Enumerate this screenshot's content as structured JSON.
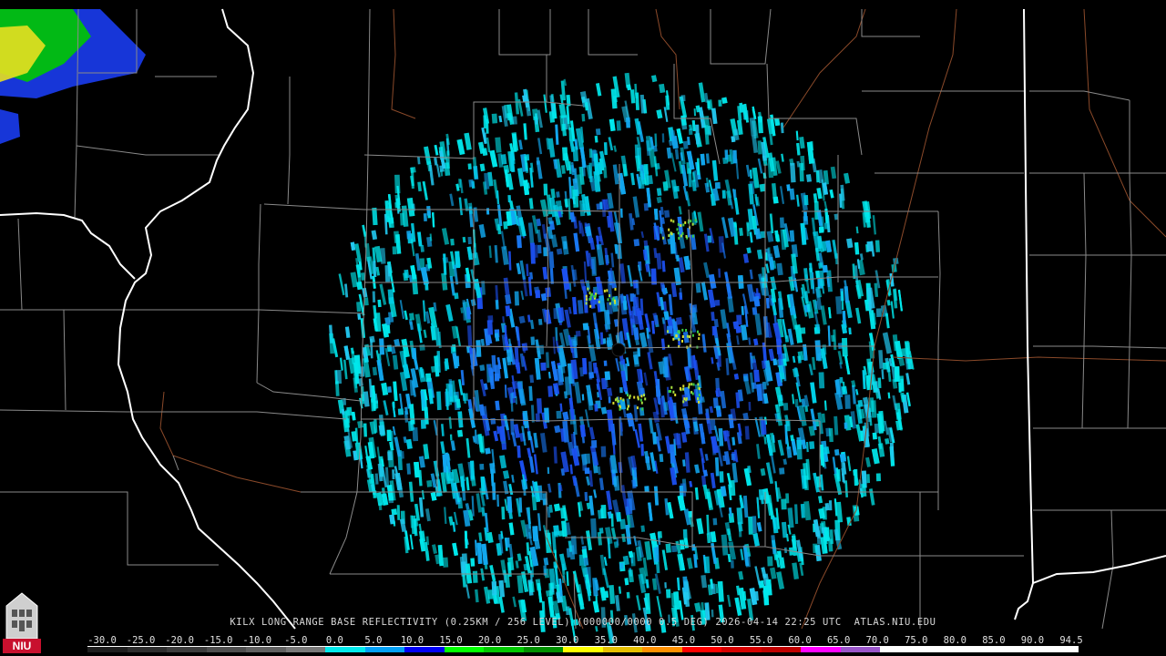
{
  "product": {
    "caption": "KILX LONG RANGE BASE REFLECTIVITY (0.25KM / 256 LEVEL) (000000/0000 0.5 DEG) 2026-04-14 22:25 UTC  ATLAS.NIU.EDU"
  },
  "logo": {
    "text": "NIU",
    "bg_color": "#c8102e"
  },
  "colorscale": {
    "labels": [
      "-30.0",
      "-25.0",
      "-20.0",
      "-15.0",
      "-10.0",
      "-5.0",
      "0.0",
      "5.0",
      "10.0",
      "15.0",
      "20.0",
      "25.0",
      "30.0",
      "35.0",
      "40.0",
      "45.0",
      "50.0",
      "55.0",
      "60.0",
      "65.0",
      "70.0",
      "75.0",
      "80.0",
      "85.0",
      "90.0",
      "94.5"
    ],
    "colors": [
      "#1e1e1e",
      "#2d2d2d",
      "#3c3c3c",
      "#4e4e4e",
      "#606060",
      "#787878",
      "#00eaec",
      "#01a0f6",
      "#0000f6",
      "#00ff00",
      "#00c800",
      "#009000",
      "#ffff00",
      "#e7c000",
      "#ff9000",
      "#ff0000",
      "#d60000",
      "#c00000",
      "#ff00ff",
      "#9955c9",
      "#ffffff",
      "#ffffff",
      "#ffffff",
      "#ffffff",
      "#ffffff"
    ]
  },
  "map": {
    "radar_site": "KILX",
    "echo_colors": [
      "#00e8ec",
      "#00d0e8",
      "#12a8f0",
      "#1a78f4",
      "#1c50f0",
      "#22c8f0"
    ],
    "spot_colors": [
      "#3ccc44",
      "#a8e040",
      "#dcdc30"
    ],
    "border_colors": {
      "state": "#ffffff",
      "county": "#8a8a8a",
      "river": "#8b4a2a"
    }
  }
}
